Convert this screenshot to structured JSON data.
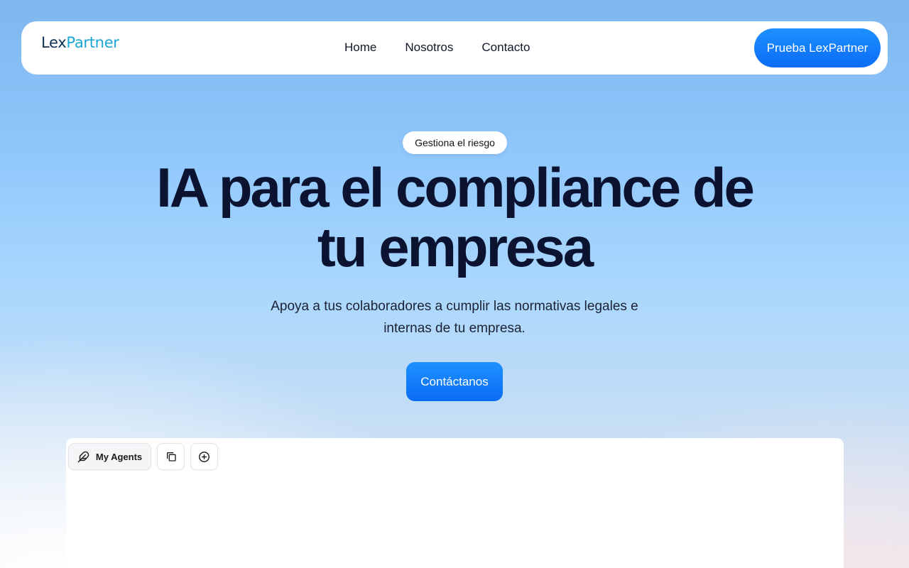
{
  "brand": {
    "name_part1": "Lex",
    "name_part2": "Partner"
  },
  "nav": {
    "links": [
      {
        "label": "Home"
      },
      {
        "label": "Nosotros"
      },
      {
        "label": "Contacto"
      }
    ],
    "cta_label": "Prueba LexPartner"
  },
  "hero": {
    "badge": "Gestiona el riesgo",
    "title_line1": "IA para el compliance de",
    "title_line2": "tu empresa",
    "subtitle_line1": "Apoya a tus colaboradores a cumplir las normativas legales e",
    "subtitle_line2": "internas de tu empresa.",
    "cta_label": "Contáctanos"
  },
  "preview": {
    "toolbar": {
      "agents_label": "My Agents",
      "agents_icon": "feather-icon",
      "copy_icon": "copy-icon",
      "add_icon": "plus-circle-icon"
    }
  },
  "colors": {
    "primary": "#0a6cf5",
    "logo_dark": "#0e3355",
    "logo_accent": "#1ba6d6",
    "title": "#0c1330"
  }
}
